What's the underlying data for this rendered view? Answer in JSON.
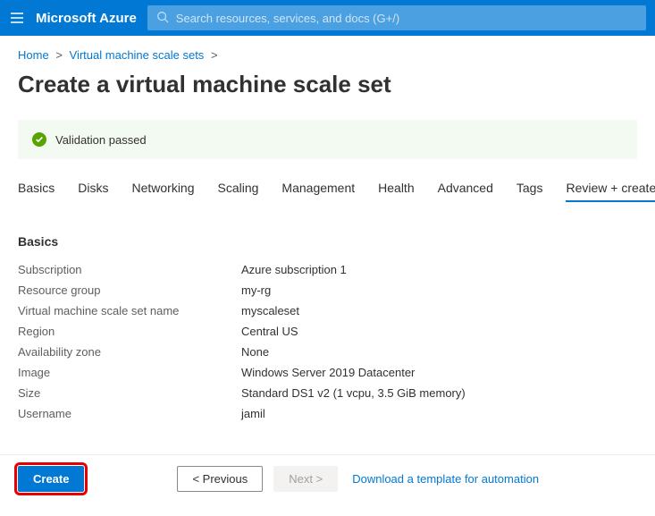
{
  "header": {
    "brand": "Microsoft Azure",
    "search_placeholder": "Search resources, services, and docs (G+/)"
  },
  "breadcrumb": {
    "items": [
      "Home",
      "Virtual machine scale sets"
    ]
  },
  "page": {
    "title": "Create a virtual machine scale set"
  },
  "validation": {
    "message": "Validation passed"
  },
  "tabs": {
    "items": [
      "Basics",
      "Disks",
      "Networking",
      "Scaling",
      "Management",
      "Health",
      "Advanced",
      "Tags",
      "Review + create"
    ],
    "active_index": 8
  },
  "review": {
    "section_title": "Basics",
    "rows": [
      {
        "label": "Subscription",
        "value": "Azure subscription 1"
      },
      {
        "label": "Resource group",
        "value": "my-rg"
      },
      {
        "label": "Virtual machine scale set name",
        "value": "myscaleset"
      },
      {
        "label": "Region",
        "value": "Central US"
      },
      {
        "label": "Availability zone",
        "value": "None"
      },
      {
        "label": "Image",
        "value": "Windows Server 2019 Datacenter"
      },
      {
        "label": "Size",
        "value": "Standard DS1 v2 (1 vcpu, 3.5 GiB memory)"
      },
      {
        "label": "Username",
        "value": "jamil"
      }
    ]
  },
  "footer": {
    "create_label": "Create",
    "prev_label": "< Previous",
    "next_label": "Next >",
    "download_label": "Download a template for automation"
  }
}
